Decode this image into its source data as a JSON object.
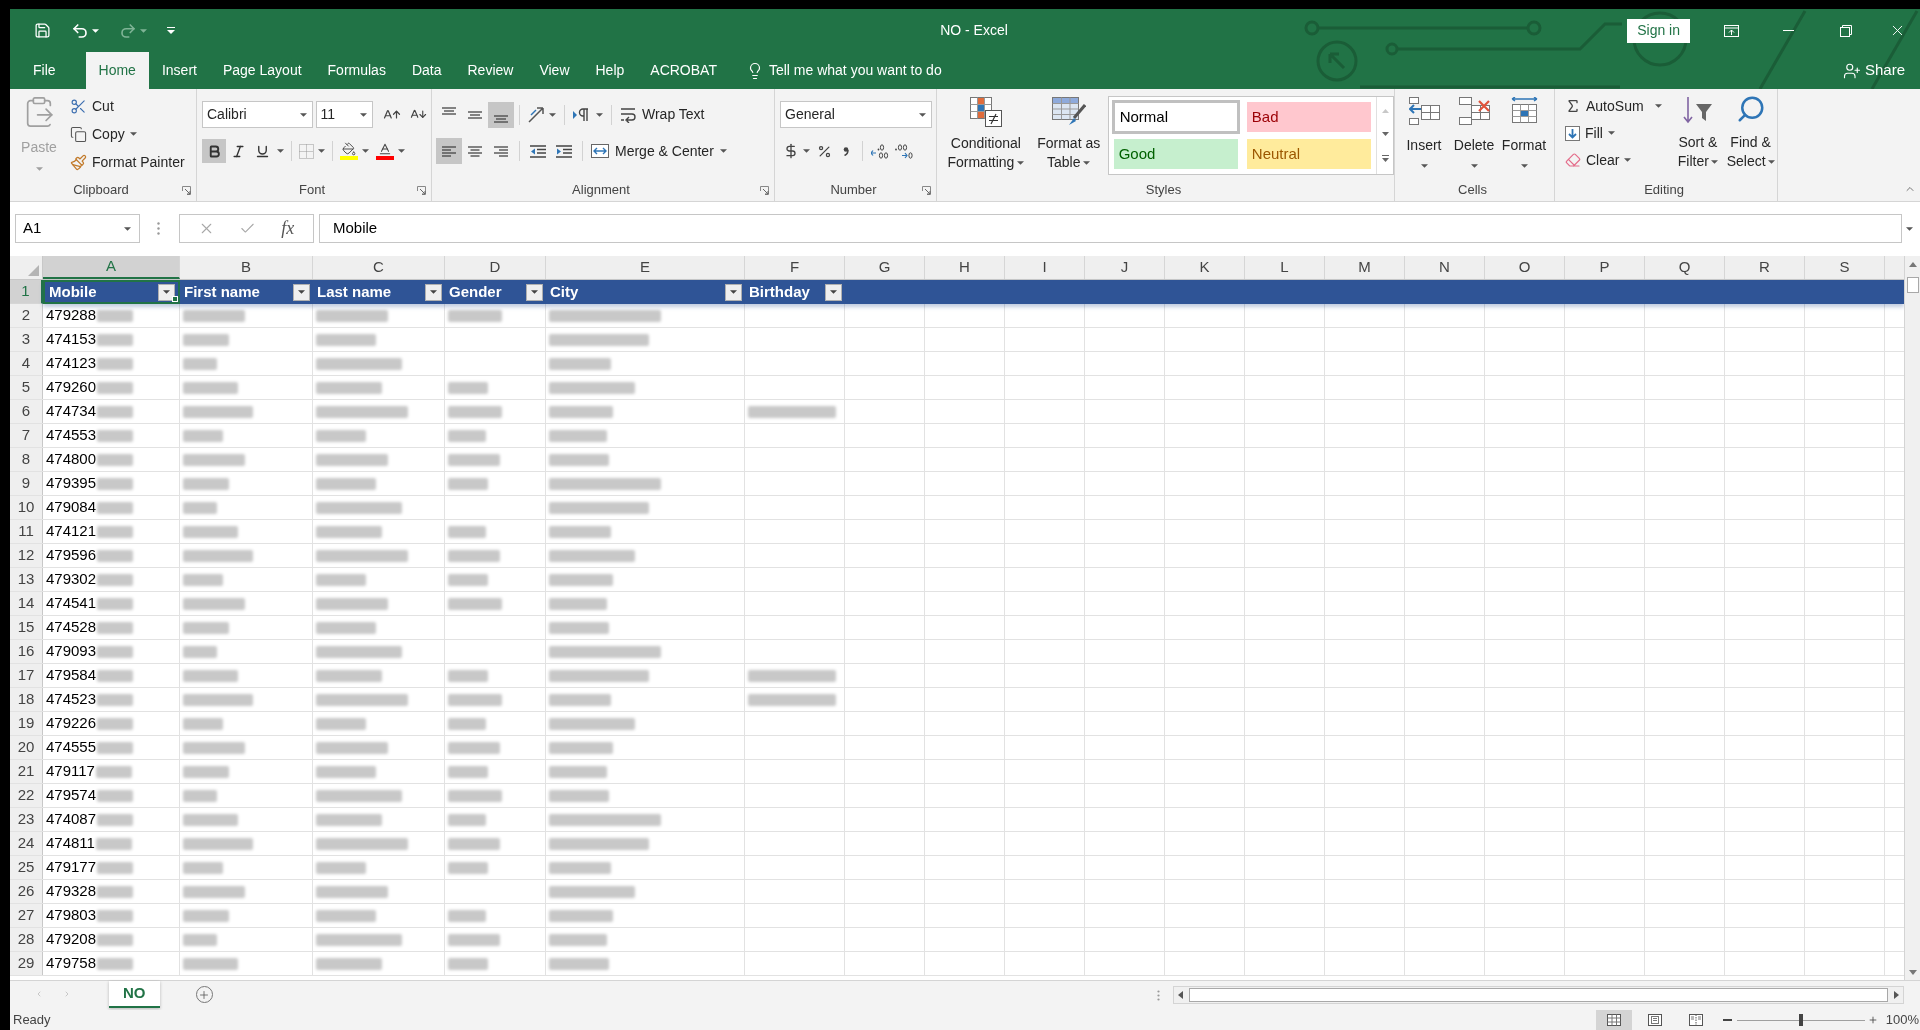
{
  "window": {
    "title": "NO - Excel",
    "sign_in": "Sign in"
  },
  "quick_access": [
    {
      "kind": "save",
      "disabled": false
    },
    {
      "kind": "undo",
      "disabled": false
    },
    {
      "kind": "redo",
      "disabled": true
    },
    {
      "kind": "customize",
      "disabled": false
    }
  ],
  "tabs": [
    {
      "label": "File",
      "selected": false
    },
    {
      "label": "Home",
      "selected": true
    },
    {
      "label": "Insert",
      "selected": false
    },
    {
      "label": "Page Layout",
      "selected": false
    },
    {
      "label": "Formulas",
      "selected": false
    },
    {
      "label": "Data",
      "selected": false
    },
    {
      "label": "Review",
      "selected": false
    },
    {
      "label": "View",
      "selected": false
    },
    {
      "label": "Help",
      "selected": false
    },
    {
      "label": "ACROBAT",
      "selected": false
    }
  ],
  "tell_me": {
    "placeholder": "Tell me what you want to do"
  },
  "share": "Share",
  "ribbon": {
    "clipboard": {
      "label": "Clipboard",
      "paste": {
        "label": "Paste",
        "disabled": true
      },
      "cut": "Cut",
      "copy": "Copy",
      "format_painter": "Format Painter"
    },
    "font": {
      "label": "Font",
      "name": "Calibri",
      "size": "11",
      "toggles": [
        {
          "kind": "bold",
          "selected": true
        },
        {
          "kind": "italic",
          "selected": false
        },
        {
          "kind": "underline",
          "selected": false
        }
      ]
    },
    "alignment": {
      "label": "Alignment",
      "vertical": [
        {
          "kind": "top",
          "selected": false
        },
        {
          "kind": "middle",
          "selected": false
        },
        {
          "kind": "bottom",
          "selected": true
        }
      ],
      "horizontal": [
        {
          "kind": "left",
          "selected": true
        },
        {
          "kind": "center",
          "selected": false
        },
        {
          "kind": "right",
          "selected": false
        }
      ],
      "wrap_text": "Wrap Text",
      "merge_center": "Merge & Center"
    },
    "number": {
      "label": "Number",
      "format": "General"
    },
    "styles": {
      "label": "Styles",
      "conditional_formatting": [
        "Conditional",
        "Formatting"
      ],
      "format_as_table": [
        "Format as",
        "Table"
      ],
      "cell_styles": [
        {
          "kind": "normal",
          "label": "Normal",
          "selected": true
        },
        {
          "kind": "bad",
          "label": "Bad",
          "selected": false
        },
        {
          "kind": "good",
          "label": "Good",
          "selected": false
        },
        {
          "kind": "neutral",
          "label": "Neutral",
          "selected": false
        }
      ]
    },
    "cells": {
      "label": "Cells",
      "buttons": [
        {
          "kind": "insert",
          "label": "Insert"
        },
        {
          "kind": "delete",
          "label": "Delete"
        },
        {
          "kind": "format",
          "label": "Format"
        }
      ]
    },
    "editing": {
      "label": "Editing",
      "autosum": "AutoSum",
      "fill": "Fill",
      "clear": "Clear",
      "sort_filter": [
        "Sort &",
        "Filter"
      ],
      "find_select": [
        "Find &",
        "Select"
      ]
    }
  },
  "formula_bar": {
    "name_box": "A1",
    "insert_function": "fx",
    "value": "Mobile"
  },
  "sheet": {
    "columns": [
      {
        "label": "A",
        "selected": true
      },
      {
        "label": "B",
        "selected": false
      },
      {
        "label": "C",
        "selected": false
      },
      {
        "label": "D",
        "selected": false
      },
      {
        "label": "E",
        "selected": false
      },
      {
        "label": "F",
        "selected": false
      },
      {
        "label": "G",
        "selected": false
      },
      {
        "label": "H",
        "selected": false
      },
      {
        "label": "I",
        "selected": false
      },
      {
        "label": "J",
        "selected": false
      },
      {
        "label": "K",
        "selected": false
      },
      {
        "label": "L",
        "selected": false
      },
      {
        "label": "M",
        "selected": false
      },
      {
        "label": "N",
        "selected": false
      },
      {
        "label": "O",
        "selected": false
      },
      {
        "label": "P",
        "selected": false
      },
      {
        "label": "Q",
        "selected": false
      },
      {
        "label": "R",
        "selected": false
      },
      {
        "label": "S",
        "selected": false
      }
    ],
    "header_row": {
      "number": "1",
      "selected": true,
      "cells": [
        {
          "label": "Mobile",
          "selected": true
        },
        {
          "label": "First name",
          "selected": false
        },
        {
          "label": "Last name",
          "selected": false
        },
        {
          "label": "Gender",
          "selected": false
        },
        {
          "label": "City",
          "selected": false
        },
        {
          "label": "Birthday",
          "selected": false
        }
      ]
    },
    "rows": [
      {
        "number": "2",
        "selected": false,
        "mobile": "479288",
        "redacted": [
          true,
          true,
          true,
          true,
          true,
          false
        ]
      },
      {
        "number": "3",
        "selected": false,
        "mobile": "474153",
        "redacted": [
          true,
          true,
          true,
          false,
          true,
          false
        ]
      },
      {
        "number": "4",
        "selected": false,
        "mobile": "474123",
        "redacted": [
          true,
          true,
          true,
          false,
          true,
          false
        ]
      },
      {
        "number": "5",
        "selected": false,
        "mobile": "479260",
        "redacted": [
          true,
          true,
          true,
          true,
          true,
          false
        ]
      },
      {
        "number": "6",
        "selected": false,
        "mobile": "474734",
        "redacted": [
          true,
          true,
          true,
          true,
          true,
          true
        ]
      },
      {
        "number": "7",
        "selected": false,
        "mobile": "474553",
        "redacted": [
          true,
          true,
          true,
          true,
          true,
          false
        ]
      },
      {
        "number": "8",
        "selected": false,
        "mobile": "474800",
        "redacted": [
          true,
          true,
          true,
          true,
          true,
          false
        ]
      },
      {
        "number": "9",
        "selected": false,
        "mobile": "479395",
        "redacted": [
          true,
          true,
          true,
          true,
          true,
          false
        ]
      },
      {
        "number": "10",
        "selected": false,
        "mobile": "479084",
        "redacted": [
          true,
          true,
          true,
          false,
          true,
          false
        ]
      },
      {
        "number": "11",
        "selected": false,
        "mobile": "474121",
        "redacted": [
          true,
          true,
          true,
          true,
          true,
          false
        ]
      },
      {
        "number": "12",
        "selected": false,
        "mobile": "479596",
        "redacted": [
          true,
          true,
          true,
          true,
          true,
          false
        ]
      },
      {
        "number": "13",
        "selected": false,
        "mobile": "479302",
        "redacted": [
          true,
          true,
          true,
          true,
          true,
          false
        ]
      },
      {
        "number": "14",
        "selected": false,
        "mobile": "474541",
        "redacted": [
          true,
          true,
          true,
          true,
          true,
          false
        ]
      },
      {
        "number": "15",
        "selected": false,
        "mobile": "474528",
        "redacted": [
          true,
          true,
          true,
          false,
          true,
          false
        ]
      },
      {
        "number": "16",
        "selected": false,
        "mobile": "479093",
        "redacted": [
          true,
          true,
          true,
          false,
          true,
          false
        ]
      },
      {
        "number": "17",
        "selected": false,
        "mobile": "479584",
        "redacted": [
          true,
          true,
          true,
          true,
          true,
          true
        ]
      },
      {
        "number": "18",
        "selected": false,
        "mobile": "474523",
        "redacted": [
          true,
          true,
          true,
          true,
          true,
          true
        ]
      },
      {
        "number": "19",
        "selected": false,
        "mobile": "479226",
        "redacted": [
          true,
          true,
          true,
          true,
          true,
          false
        ]
      },
      {
        "number": "20",
        "selected": false,
        "mobile": "474555",
        "redacted": [
          true,
          true,
          true,
          true,
          true,
          false
        ]
      },
      {
        "number": "21",
        "selected": false,
        "mobile": "479117",
        "redacted": [
          true,
          true,
          true,
          true,
          true,
          false
        ]
      },
      {
        "number": "22",
        "selected": false,
        "mobile": "479574",
        "redacted": [
          true,
          true,
          true,
          true,
          true,
          false
        ]
      },
      {
        "number": "23",
        "selected": false,
        "mobile": "474087",
        "redacted": [
          true,
          true,
          true,
          true,
          true,
          false
        ]
      },
      {
        "number": "24",
        "selected": false,
        "mobile": "474811",
        "redacted": [
          true,
          true,
          true,
          true,
          true,
          false
        ]
      },
      {
        "number": "25",
        "selected": false,
        "mobile": "479177",
        "redacted": [
          true,
          true,
          true,
          true,
          true,
          false
        ]
      },
      {
        "number": "26",
        "selected": false,
        "mobile": "479328",
        "redacted": [
          true,
          true,
          true,
          false,
          true,
          false
        ]
      },
      {
        "number": "27",
        "selected": false,
        "mobile": "479803",
        "redacted": [
          true,
          true,
          true,
          true,
          true,
          false
        ]
      },
      {
        "number": "28",
        "selected": false,
        "mobile": "479208",
        "redacted": [
          true,
          true,
          true,
          true,
          true,
          false
        ]
      },
      {
        "number": "29",
        "selected": false,
        "mobile": "479758",
        "redacted": [
          true,
          true,
          true,
          true,
          true,
          false
        ]
      }
    ]
  },
  "sheet_tabs": [
    {
      "label": "NO",
      "selected": true
    }
  ],
  "status_bar": {
    "status": "Ready",
    "views": [
      {
        "kind": "normal",
        "selected": true
      },
      {
        "kind": "page_layout",
        "selected": false
      },
      {
        "kind": "page_break",
        "selected": false
      }
    ],
    "zoom": {
      "level": 0.5,
      "reading": "100%"
    }
  }
}
